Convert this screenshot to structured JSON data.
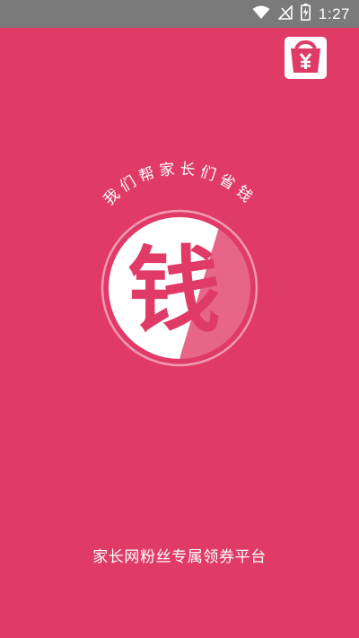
{
  "status_bar": {
    "time": "1:27",
    "icons": [
      "wifi-icon",
      "no-signal-icon",
      "battery-charging-icon"
    ]
  },
  "app": {
    "corner_logo_icon": "savings-wallet-yen-icon",
    "emblem": {
      "arc_text": "我们帮家长们省钱",
      "big_char": "钱"
    },
    "tagline": "家长网粉丝专属领券平台"
  },
  "colors": {
    "background": "#e03a66",
    "status_bar": "#7a7a7a",
    "text": "#ffffff"
  }
}
